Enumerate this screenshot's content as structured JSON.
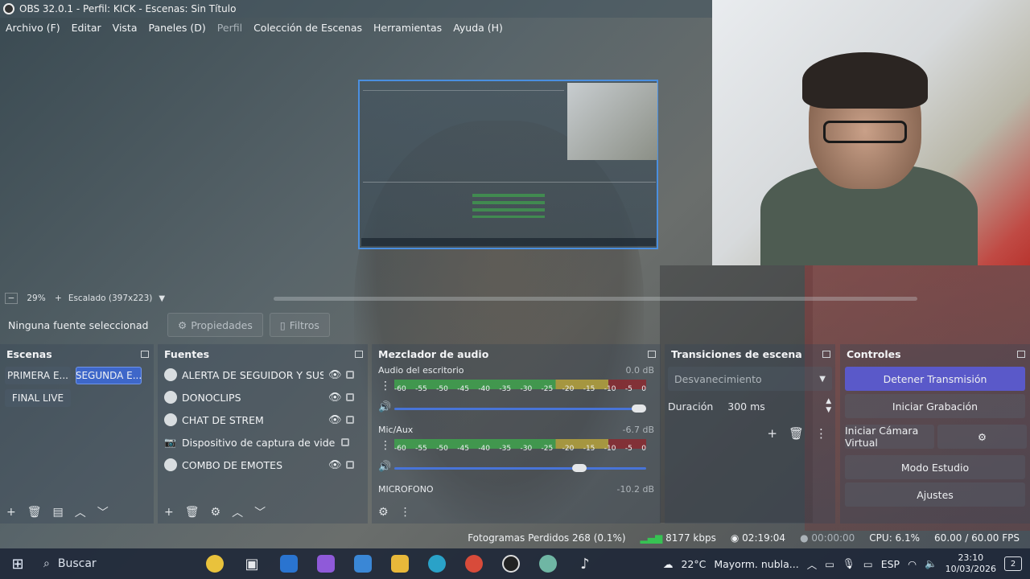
{
  "window": {
    "title": "OBS 32.0.1 - Perfil: KICK - Escenas: Sin Título"
  },
  "menu": [
    {
      "label": "Archivo (F)",
      "enabled": true
    },
    {
      "label": "Editar",
      "enabled": true
    },
    {
      "label": "Vista",
      "enabled": true
    },
    {
      "label": "Paneles (D)",
      "enabled": true
    },
    {
      "label": "Perfil",
      "enabled": false
    },
    {
      "label": "Colección de Escenas",
      "enabled": true
    },
    {
      "label": "Herramientas",
      "enabled": true
    },
    {
      "label": "Ayuda (H)",
      "enabled": true
    }
  ],
  "preview": {
    "zoom": "29%",
    "scaling": "Escalado (397x223)"
  },
  "source_toolbar": {
    "no_selection": "Ninguna fuente seleccionad",
    "properties": "Propiedades",
    "filters": "Filtros"
  },
  "scenes": {
    "title": "Escenas",
    "items": [
      {
        "label": "PRIMERA E...",
        "active": false
      },
      {
        "label": "SEGUNDA E...",
        "active": true
      },
      {
        "label": "FINAL LIVE",
        "active": false
      }
    ]
  },
  "sources": {
    "title": "Fuentes",
    "items": [
      {
        "label": "ALERTA DE SEGUIDOR Y SUSCRI",
        "icon": "browser-icon",
        "visible": true
      },
      {
        "label": "DONOCLIPS",
        "icon": "browser-icon",
        "visible": true
      },
      {
        "label": "CHAT DE STREM",
        "icon": "browser-icon",
        "visible": true
      },
      {
        "label": "Dispositivo de captura de video",
        "icon": "camera-icon",
        "visible": false
      },
      {
        "label": "COMBO DE EMOTES",
        "icon": "browser-icon",
        "visible": true
      }
    ]
  },
  "mixer": {
    "title": "Mezclador de audio",
    "scale": [
      "-60",
      "-55",
      "-50",
      "-45",
      "-40",
      "-35",
      "-30",
      "-25",
      "-20",
      "-15",
      "-10",
      "-5",
      "0"
    ],
    "channels": [
      {
        "name": "Audio del escritorio",
        "db": "0.0 dB",
        "volume": 1.0
      },
      {
        "name": "Mic/Aux",
        "db": "-6.7 dB",
        "volume": 0.75
      },
      {
        "name": "MICROFONO",
        "db": "-10.2 dB",
        "volume": null
      }
    ]
  },
  "transitions": {
    "title": "Transiciones de escena",
    "selected": "Desvanecimiento",
    "duration_label": "Duración",
    "duration_value": "300 ms"
  },
  "controls": {
    "title": "Controles",
    "stream": "Detener Transmisión",
    "record": "Iniciar Grabación",
    "virtual_cam": "Iniciar Cámara Virtual",
    "studio": "Modo Estudio",
    "settings": "Ajustes"
  },
  "status": {
    "dropped": "Fotogramas Perdidos 268 (0.1%)",
    "bitrate": "8177 kbps",
    "stream_time": "02:19:04",
    "rec_time": "00:00:00",
    "cpu": "CPU: 6.1%",
    "fps": "60.00 / 60.00 FPS"
  },
  "taskbar": {
    "search": "Buscar",
    "weather_temp": "22°C",
    "weather_text": "Mayorm. nubla...",
    "lang": "ESP",
    "time": "23:10",
    "date": "10/03/2026",
    "notifications": "2"
  }
}
